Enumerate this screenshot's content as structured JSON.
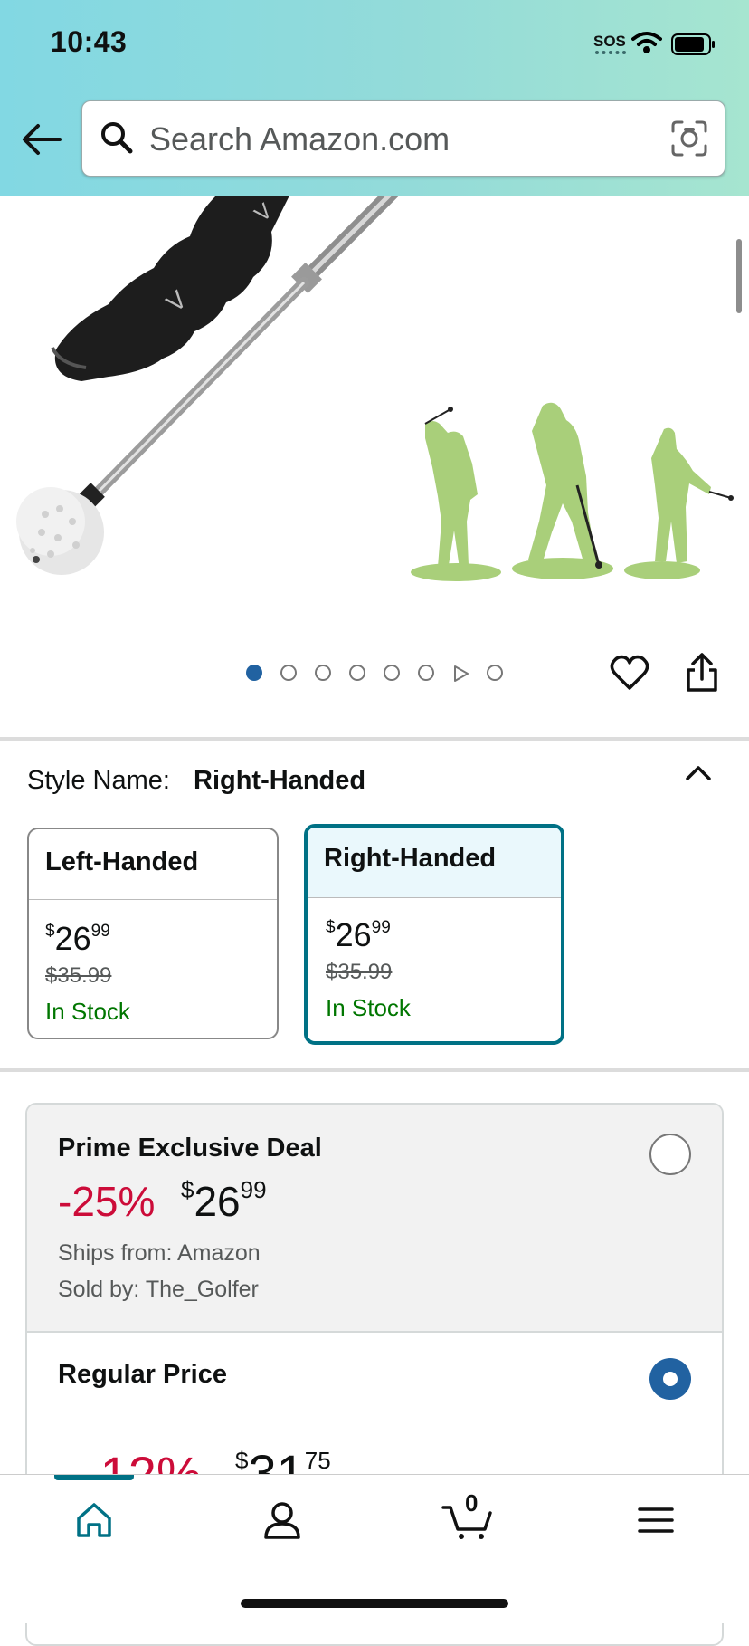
{
  "status_bar": {
    "time": "10:43",
    "sos": "SOS"
  },
  "search": {
    "placeholder": "Search Amazon.com"
  },
  "gallery": {
    "image_count": 8,
    "active_index": 0,
    "video_index": 6
  },
  "style": {
    "label": "Style Name:",
    "selected": "Right-Handed",
    "options": [
      {
        "name": "Left-Handed",
        "price_whole": "26",
        "price_cents": "99",
        "list_price": "$35.99",
        "stock": "In Stock",
        "selected": false
      },
      {
        "name": "Right-Handed",
        "price_whole": "26",
        "price_cents": "99",
        "list_price": "$35.99",
        "stock": "In Stock",
        "selected": true
      }
    ]
  },
  "deals": {
    "prime": {
      "title": "Prime Exclusive Deal",
      "discount": "-25%",
      "price_whole": "26",
      "price_cents": "99",
      "ships_from": "Ships from: Amazon",
      "sold_by": "Sold by: The_Golfer",
      "selected": false
    },
    "regular": {
      "title": "Regular Price",
      "discount": "-12%",
      "price_whole": "31",
      "price_cents": "75",
      "selected": true
    }
  },
  "currency_symbol": "$",
  "tabbar": {
    "cart_count": "0",
    "active": "home"
  },
  "colors": {
    "accent_teal": "#007185",
    "link_blue": "#2162a1",
    "deal_red": "#cc0c39",
    "stock_green": "#007600"
  }
}
